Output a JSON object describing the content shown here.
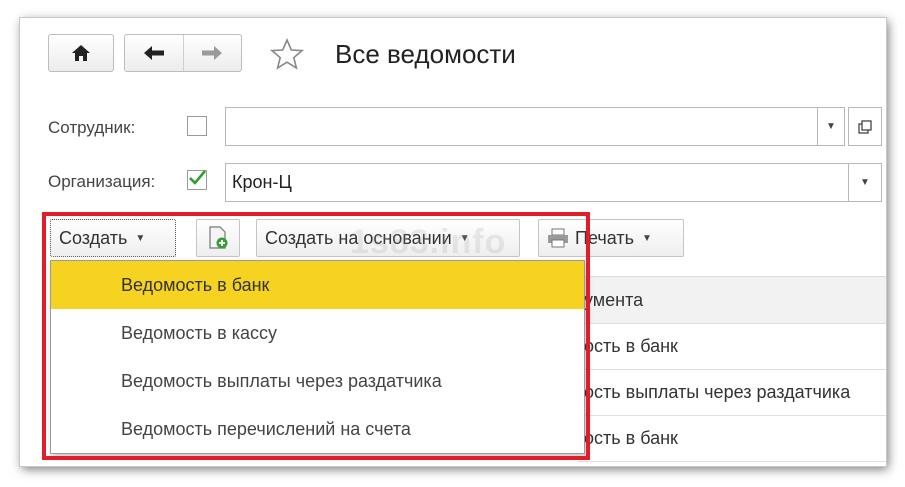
{
  "window": {
    "title": "Все ведомости"
  },
  "nav": {
    "home_icon": "home-icon",
    "back_icon": "arrow-left-icon",
    "forward_icon": "arrow-right-icon",
    "favorite_icon": "star-icon"
  },
  "filters": {
    "employee_label": "Сотрудник:",
    "employee_value": "",
    "employee_checked": false,
    "organization_label": "Организация:",
    "organization_value": "Крон-Ц",
    "organization_checked": true
  },
  "toolbar": {
    "create_label": "Создать",
    "create_based_label": "Создать на основании",
    "print_label": "Печать"
  },
  "watermark": "1s83.info",
  "table": {
    "header": "умента",
    "rows": [
      "ость в банк",
      "ость выплаты через раздатчика",
      "ость в банк"
    ]
  },
  "create_menu": {
    "items": [
      "Ведомость в банк",
      "Ведомость в кассу",
      "Ведомость выплаты через раздатчика",
      "Ведомость перечислений на счета"
    ],
    "active_index": 0
  },
  "colors": {
    "highlight": "#f5d320",
    "callout": "#e11d2c",
    "check": "#2aa02a"
  }
}
